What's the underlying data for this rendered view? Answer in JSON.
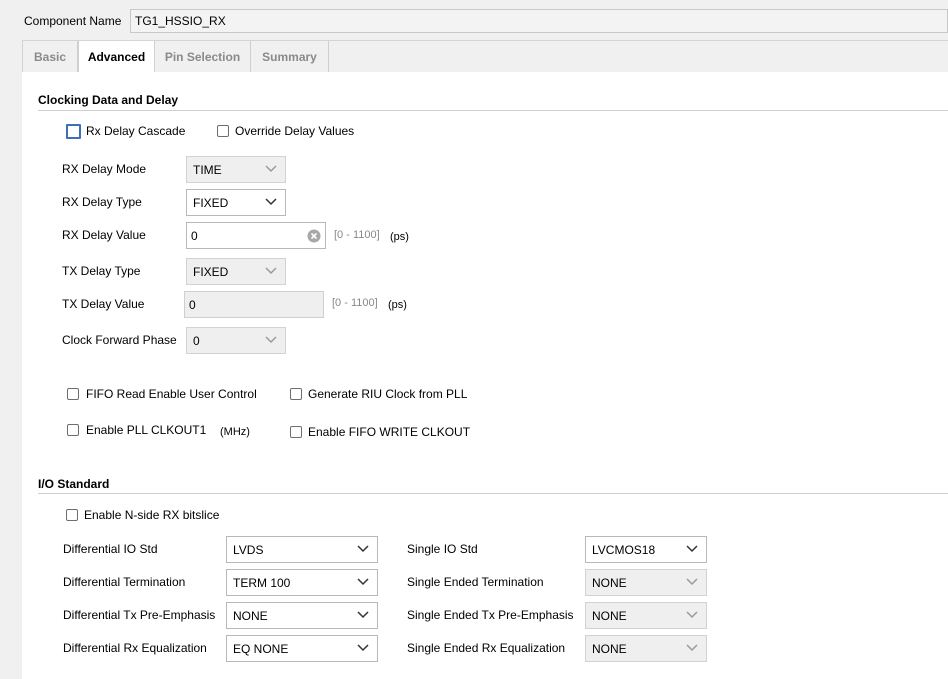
{
  "header": {
    "component_name_label": "Component Name",
    "component_name_value": "TG1_HSSIO_RX"
  },
  "tabs": [
    "Basic",
    "Advanced",
    "Pin Selection",
    "Summary"
  ],
  "clocking": {
    "title": "Clocking Data and Delay",
    "rx_delay_cascade": "Rx Delay Cascade",
    "override_delay_values": "Override Delay Values",
    "rx_delay_mode_label": "RX Delay Mode",
    "rx_delay_mode_value": "TIME",
    "rx_delay_type_label": "RX Delay Type",
    "rx_delay_type_value": "FIXED",
    "rx_delay_value_label": "RX Delay Value",
    "rx_delay_value": "0",
    "rx_delay_range": "[0 - 1100]",
    "rx_delay_unit": "(ps)",
    "tx_delay_type_label": "TX Delay Type",
    "tx_delay_type_value": "FIXED",
    "tx_delay_value_label": "TX Delay Value",
    "tx_delay_value": "0",
    "tx_delay_range": "[0 - 1100]",
    "tx_delay_unit": "(ps)",
    "clock_forward_phase_label": "Clock Forward Phase",
    "clock_forward_phase_value": "0",
    "fifo_read_enable": "FIFO Read Enable User Control",
    "generate_riu_clock": "Generate RIU Clock from PLL",
    "enable_pll_clkout1": "Enable PLL CLKOUT1",
    "pll_unit": "(MHz)",
    "enable_fifo_write_clkout": "Enable FIFO WRITE CLKOUT"
  },
  "io": {
    "title": "I/O Standard",
    "enable_nside": "Enable N-side RX bitslice",
    "diff_io_std_label": "Differential IO Std",
    "diff_io_std_value": "LVDS",
    "diff_term_label": "Differential Termination",
    "diff_term_value": "TERM 100",
    "diff_tx_pre_label": "Differential Tx Pre-Emphasis",
    "diff_tx_pre_value": "NONE",
    "diff_rx_eq_label": "Differential Rx Equalization",
    "diff_rx_eq_value": "EQ NONE",
    "single_io_std_label": "Single IO Std",
    "single_io_std_value": "LVCMOS18",
    "single_term_label": "Single Ended Termination",
    "single_term_value": "NONE",
    "single_tx_pre_label": "Single Ended Tx Pre-Emphasis",
    "single_tx_pre_value": "NONE",
    "single_rx_eq_label": "Single Ended Rx Equalization",
    "single_rx_eq_value": "NONE"
  },
  "colors": {
    "focus_border": "#3f6fb8",
    "panel_bg": "#ffffff",
    "window_bg": "#f0f0f0"
  }
}
